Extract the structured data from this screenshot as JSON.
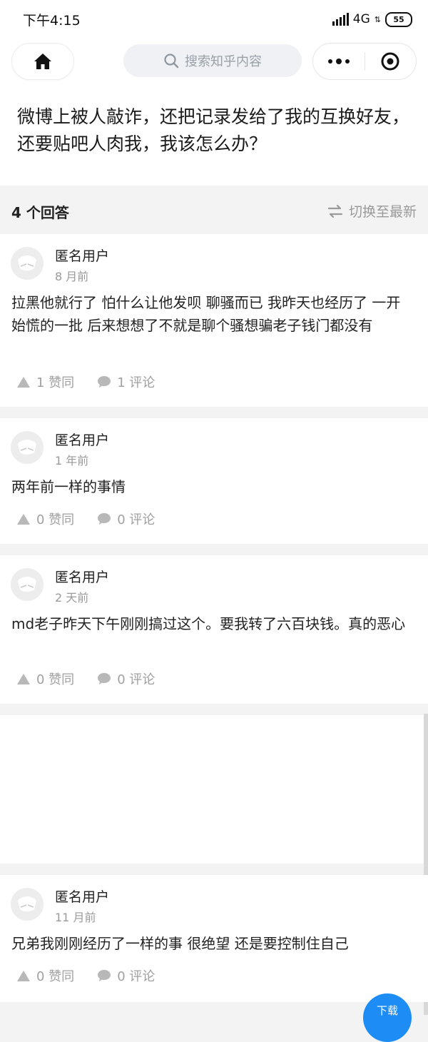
{
  "status_bar": {
    "time": "下午4:15",
    "network": "4G",
    "battery": "55"
  },
  "nav": {
    "search_placeholder": "搜索知乎内容"
  },
  "question": {
    "title": "微博上被人敲诈，还把记录发给了我的互换好友，还要贴吧人肉我，我该怎么办？"
  },
  "answers_header": {
    "count_label": "4 个回答",
    "switch_label": "切换至最新"
  },
  "answers": [
    {
      "author": "匿名用户",
      "time": "8 月前",
      "content": "拉黑他就行了 怕什么让他发呗 聊骚而已 我昨天也经历了 一开始慌的一批 后来想想了不就是聊个骚想骗老子钱门都没有",
      "upvote_label": "1 赞同",
      "comment_label": "1 评论"
    },
    {
      "author": "匿名用户",
      "time": "1 年前",
      "content": "两年前一样的事情",
      "upvote_label": "0 赞同",
      "comment_label": "0 评论"
    },
    {
      "author": "匿名用户",
      "time": "2 天前",
      "content": "md老子昨天下午刚刚搞过这个。要我转了六百块钱。真的恶心",
      "upvote_label": "0 赞同",
      "comment_label": "0 评论"
    },
    {
      "author": "匿名用户",
      "time": "11 月前",
      "content": "兄弟我刚刚经历了一样的事 很绝望 还是要控制住自己",
      "upvote_label": "0 赞同",
      "comment_label": "0 评论"
    }
  ],
  "download_button": {
    "label": "下载"
  }
}
